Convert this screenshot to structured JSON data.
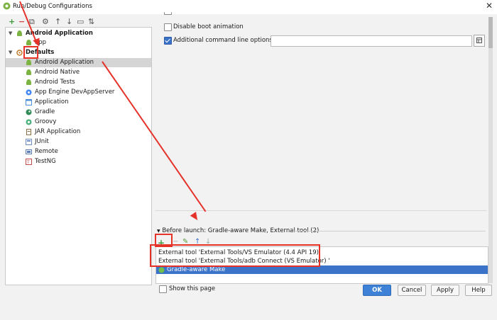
{
  "window": {
    "title": "Run/Debug Configurations",
    "close_glyph": "✕"
  },
  "toolbar": [
    {
      "name": "add-config-button",
      "glyph": "+"
    },
    {
      "name": "remove-config-button",
      "glyph": "−"
    },
    {
      "name": "copy-config-button",
      "glyph": "⧉"
    },
    {
      "name": "edit-defaults-button",
      "glyph": "⚙"
    },
    {
      "name": "move-up-button",
      "glyph": "↑"
    },
    {
      "name": "move-down-button",
      "glyph": "↓"
    },
    {
      "name": "folder-button",
      "glyph": "▭"
    },
    {
      "name": "sort-button",
      "glyph": "⇅"
    }
  ],
  "tree": {
    "android_app_group": "Android Application",
    "app_item": "app",
    "defaults_group": "Defaults",
    "defaults_items": [
      {
        "label": "Android Application",
        "icon": "android-icon",
        "color": "#7cb342"
      },
      {
        "label": "Android Native",
        "icon": "android-icon",
        "color": "#7cb342"
      },
      {
        "label": "Android Tests",
        "icon": "android-icon",
        "color": "#7cb342"
      },
      {
        "label": "App Engine DevAppServer",
        "icon": "app-engine-icon",
        "color": "#4285f4"
      },
      {
        "label": "Application",
        "icon": "application-icon",
        "color": "#4a90d9"
      },
      {
        "label": "Gradle",
        "icon": "gradle-icon",
        "color": "#2e8b57"
      },
      {
        "label": "Groovy",
        "icon": "groovy-icon",
        "color": "#4db37d"
      },
      {
        "label": "JAR Application",
        "icon": "jar-icon",
        "color": "#8c6d46"
      },
      {
        "label": "JUnit",
        "icon": "junit-icon",
        "color": "#6a8fc7"
      },
      {
        "label": "Remote",
        "icon": "remote-icon",
        "color": "#5a7fb5"
      },
      {
        "label": "TestNG",
        "icon": "testng-icon",
        "color": "#c34b4b"
      }
    ]
  },
  "options": {
    "disable_boot_animation": "Disable boot animation",
    "additional_cmd_options": "Additional command line options:",
    "additional_cmd_value": ""
  },
  "before_launch": {
    "label": "Before launch: Gradle-aware Make, External tool (2)",
    "items": [
      {
        "label": "External tool 'External Tools/VS Emulator (4.4 API 19)'",
        "selected": false
      },
      {
        "label": "External tool 'External Tools/adb Connect (VS Emulator) '",
        "selected": false
      },
      {
        "label": "Gradle-aware Make",
        "selected": true
      }
    ],
    "show_this_page": "Show this page"
  },
  "buttons": {
    "ok": "OK",
    "cancel": "Cancel",
    "apply": "Apply",
    "help": "Help"
  },
  "colors": {
    "annotation_red": "#e5332a",
    "selection_blue": "#3b73c8"
  }
}
